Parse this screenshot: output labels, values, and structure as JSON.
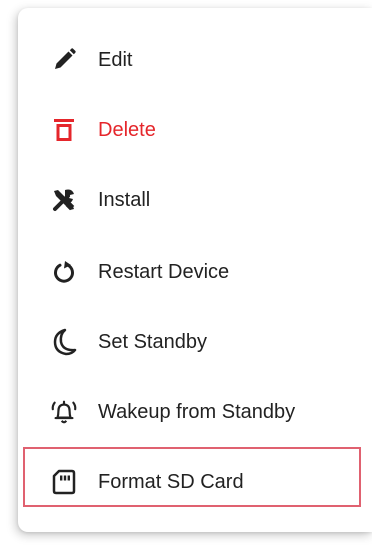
{
  "menu": {
    "items": [
      {
        "label": "Edit",
        "icon": "pencil-icon",
        "color": "#222222"
      },
      {
        "label": "Delete",
        "icon": "trash-icon",
        "color": "#e5262b"
      },
      {
        "label": "Install",
        "icon": "tools-icon",
        "color": "#222222"
      },
      {
        "label": "Restart Device",
        "icon": "restart-icon",
        "color": "#222222"
      },
      {
        "label": "Set Standby",
        "icon": "moon-icon",
        "color": "#222222"
      },
      {
        "label": "Wakeup from Standby",
        "icon": "alarm-bell-icon",
        "color": "#222222"
      },
      {
        "label": "Format SD Card",
        "icon": "sd-card-icon",
        "color": "#222222",
        "highlighted": true
      }
    ]
  },
  "colors": {
    "danger": "#e5262b",
    "highlight_border": "#e06170"
  }
}
